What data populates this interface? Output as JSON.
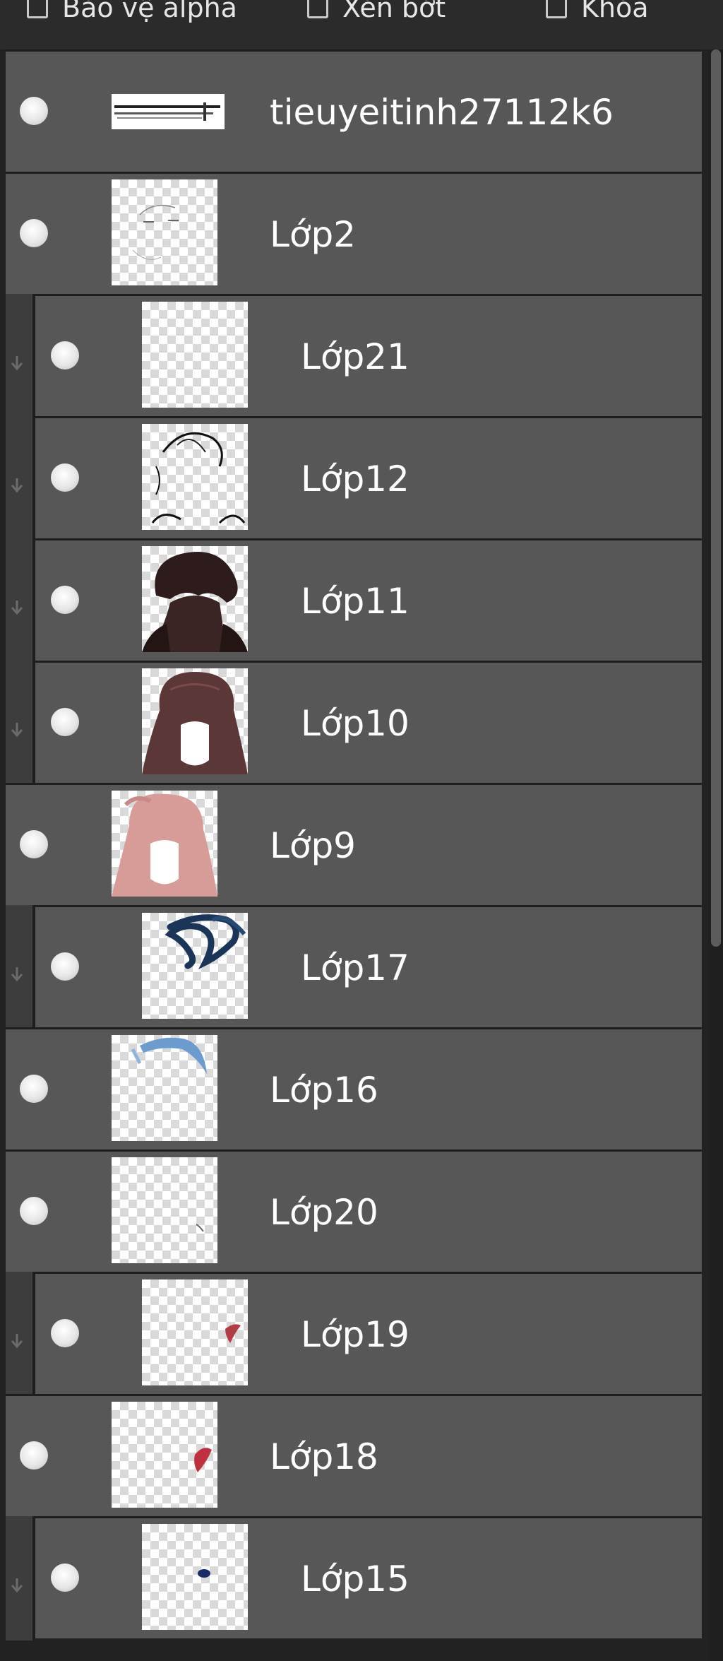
{
  "options": {
    "protect_alpha": "Bảo vệ alpha",
    "clipping": "Xén bớt",
    "lock": "Khóa"
  },
  "layers": [
    {
      "name": "tieuyeitinh27112k6",
      "clipped": false,
      "thumb": "text-thumbnail"
    },
    {
      "name": "Lớp2",
      "clipped": false,
      "thumb": "sketch-thumbnail"
    },
    {
      "name": "Lớp21",
      "clipped": true,
      "thumb": "empty-thumbnail"
    },
    {
      "name": "Lớp12",
      "clipped": true,
      "thumb": "lineart-thumbnail"
    },
    {
      "name": "Lớp11",
      "clipped": true,
      "thumb": "dark-hair-thumbnail"
    },
    {
      "name": "Lớp10",
      "clipped": true,
      "thumb": "brown-hair-thumbnail"
    },
    {
      "name": "Lớp9",
      "clipped": false,
      "thumb": "pink-hair-thumbnail"
    },
    {
      "name": "Lớp17",
      "clipped": true,
      "thumb": "navy-stroke-thumbnail"
    },
    {
      "name": "Lớp16",
      "clipped": false,
      "thumb": "blue-stroke-thumbnail"
    },
    {
      "name": "Lớp20",
      "clipped": false,
      "thumb": "small-mark-thumbnail"
    },
    {
      "name": "Lớp19",
      "clipped": true,
      "thumb": "red-mark-thumbnail"
    },
    {
      "name": "Lớp18",
      "clipped": false,
      "thumb": "red-mark-thumbnail"
    },
    {
      "name": "Lớp15",
      "clipped": true,
      "thumb": "navy-dot-thumbnail"
    }
  ],
  "colors": {
    "panel_bg": "#222222",
    "row_bg": "#575757",
    "clip_bar": "#3d3d3d",
    "text": "#ffffff"
  }
}
